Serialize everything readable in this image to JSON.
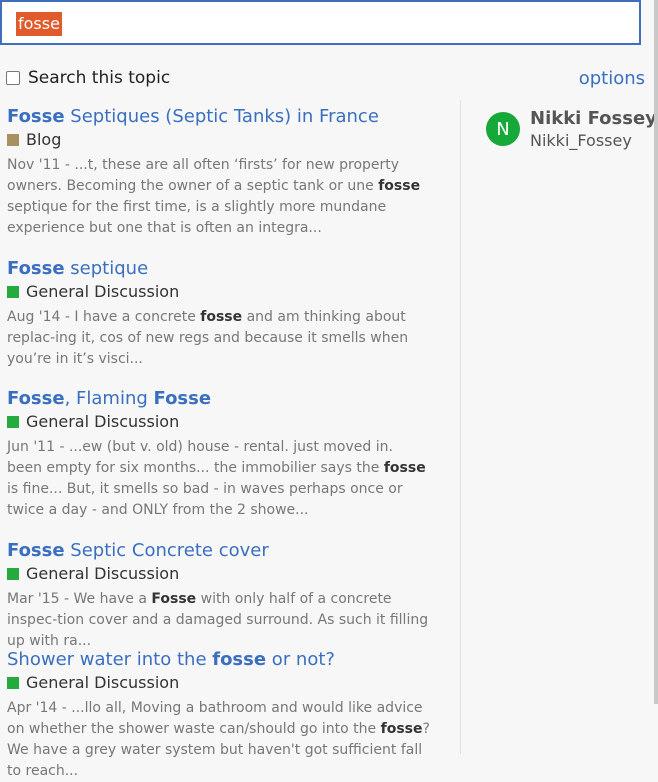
{
  "search": {
    "query": "fosse"
  },
  "filter": {
    "checkbox_label": "Search this topic",
    "checked": false
  },
  "options_label": "options",
  "results": [
    {
      "title_parts": [
        [
          "Fosse",
          true
        ],
        [
          " Septiques (Septic Tanks) in France",
          false
        ]
      ],
      "category": "Blog",
      "category_color": "#a89060",
      "blurb_parts": [
        [
          "Nov '11 - ...t, these are all often ‘firsts’ for new property owners. Becoming the owner of a septic tank or une ",
          false
        ],
        [
          "fosse",
          true
        ],
        [
          " septique for the first time, is a slightly more mundane experience but one that is often an integra...",
          false
        ]
      ]
    },
    {
      "title_parts": [
        [
          "Fosse",
          true
        ],
        [
          " septique",
          false
        ]
      ],
      "category": "General Discussion",
      "category_color": "#25aa3e",
      "blurb_parts": [
        [
          "Aug '14 - I have a concrete ",
          false
        ],
        [
          "fosse",
          true
        ],
        [
          " and am thinking about replac-ing it, cos of new regs and because it smells when you’re in it’s visci...",
          false
        ]
      ]
    },
    {
      "title_parts": [
        [
          "Fosse",
          true
        ],
        [
          ", Flaming ",
          false
        ],
        [
          "Fosse",
          true
        ]
      ],
      "category": "General Discussion",
      "category_color": "#25aa3e",
      "blurb_parts": [
        [
          "Jun '11 - ...ew (but v. old) house - rental. just moved in. been empty for six months... the immobilier says the ",
          false
        ],
        [
          "fosse",
          true
        ],
        [
          " is fine... But, it smells so bad - in waves perhaps once or twice a day - and ONLY from the 2 showe...",
          false
        ]
      ]
    },
    {
      "title_parts": [
        [
          "Fosse",
          true
        ],
        [
          " Septic Concrete cover",
          false
        ]
      ],
      "category": "General Discussion",
      "category_color": "#25aa3e",
      "blurb_parts": [
        [
          "Mar '15 - We have a ",
          false
        ],
        [
          "Fosse",
          true
        ],
        [
          " with only half of a concrete inspec-tion cover and a damaged surround. As such it filling up with ra...",
          false
        ]
      ]
    },
    {
      "title_parts": [
        [
          "Shower water into the ",
          false
        ],
        [
          "fosse",
          true
        ],
        [
          " or not?",
          false
        ]
      ],
      "category": "General Discussion",
      "category_color": "#25aa3e",
      "blurb_parts": [
        [
          "Apr '14 - ...llo all, Moving a bathroom and would like advice on whether the shower waste can/should go into the ",
          false
        ],
        [
          "fosse",
          true
        ],
        [
          "? We have a grey water system but haven't got sufficient fall to reach...",
          false
        ]
      ]
    }
  ],
  "user": {
    "avatar_letter": "N",
    "name": "Nikki Fossey",
    "handle": "Nikki_Fossey",
    "avatar_color": "#17a83a"
  }
}
